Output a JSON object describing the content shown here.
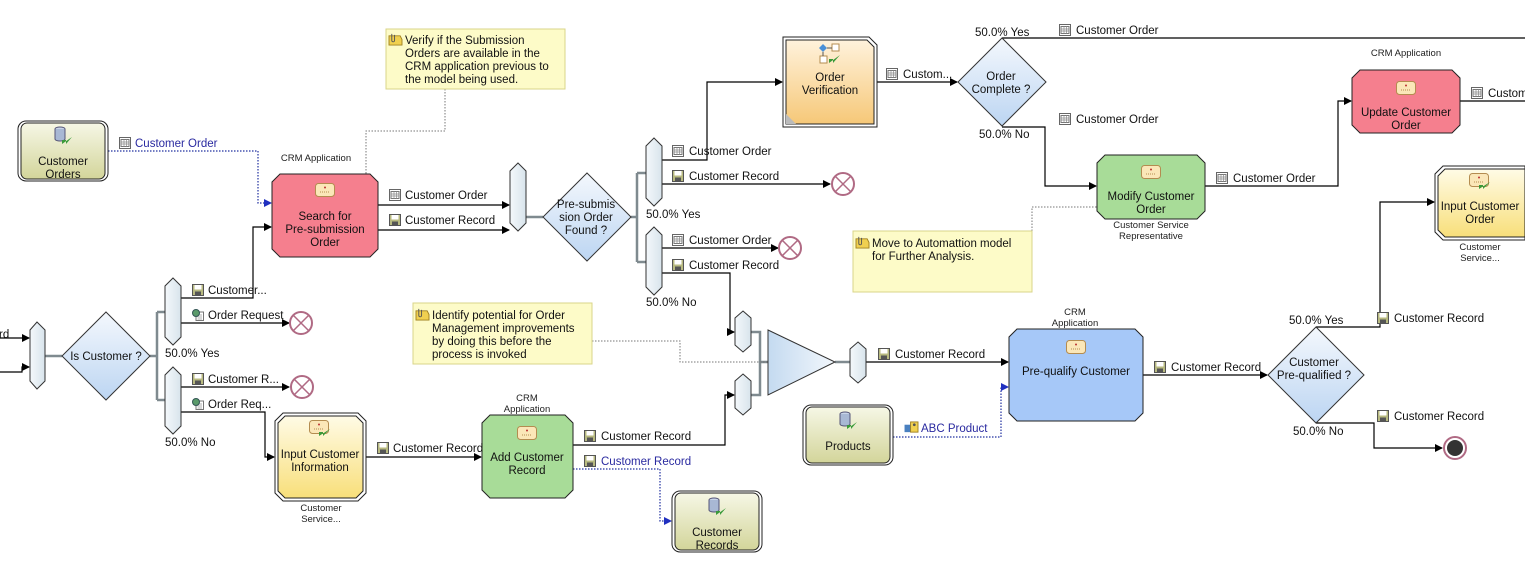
{
  "colors": {
    "crm_task": "#f57f8e",
    "human_task": "#a8dc98",
    "manual_task": "#fbe890",
    "subprocess": "#f8d08c",
    "prequalify_task": "#a6c8f8",
    "decision": "#cfe0f5",
    "note": "#fdfbc8",
    "repository": "#e0e2b0",
    "data_link": "#2a2aa0"
  },
  "repositories": {
    "customer_orders": {
      "line1": "Customer",
      "line2": "Orders",
      "icon": "database-icon"
    },
    "products": {
      "line1": "Products",
      "icon": "database-icon"
    },
    "customer_records": {
      "line1": "Customer",
      "line2": "Records",
      "icon": "database-icon"
    }
  },
  "tasks": {
    "search": {
      "line1": "Search for",
      "line2": "Pre-submission",
      "line3": "Order",
      "role": "CRM Application"
    },
    "order_verification": {
      "line1": "Order",
      "line2": "Verification"
    },
    "modify": {
      "line1": "Modify Customer",
      "line2": "Order",
      "role1": "Customer Service",
      "role2": "Representative"
    },
    "update": {
      "line1": "Update Customer",
      "line2": "Order",
      "role": "CRM Application"
    },
    "input_order": {
      "line1": "Input Customer",
      "line2": "Order",
      "role1": "Customer",
      "role2": "Service..."
    },
    "input_info": {
      "line1": "Input Customer",
      "line2": "Information",
      "role1": "Customer",
      "role2": "Service..."
    },
    "add_record": {
      "line1": "Add Customer",
      "line2": "Record",
      "role1": "CRM",
      "role2": "Application"
    },
    "prequalify": {
      "line1": "Pre-qualify Customer",
      "role1": "CRM",
      "role2": "Application"
    }
  },
  "decisions": {
    "is_customer": {
      "line1": "Is Customer ?"
    },
    "presubmission": {
      "line1": "Pre-submis",
      "line2": "sion Order",
      "line3": "Found ?"
    },
    "order_complete": {
      "line1": "Order",
      "line2": "Complete ?"
    },
    "prequalified": {
      "line1": "Customer",
      "line2": "Pre-qualified ?"
    }
  },
  "notes": {
    "verify": [
      "Verify if the Submission",
      "Orders are available in the",
      "CRM application previous to",
      "the model being used."
    ],
    "identify": [
      "Identify potential for Order",
      "Management improvements",
      "by doing this before the",
      "process is invoked"
    ],
    "automation": [
      "Move to Automattion model",
      "for Further Analysis."
    ]
  },
  "connections": {
    "left_in": "rd",
    "orders_to_search": "Customer Order",
    "search_order": "Customer Order",
    "search_record": "Customer Record",
    "yes1_order": "Customer Order",
    "yes1_record": "Customer Record",
    "yes1_pct": "50.0% Yes",
    "no1_order": "Customer Order",
    "no1_record": "Customer Record",
    "no1_pct": "50.0% No",
    "verif_out": "Custom...",
    "oc_yes_pct": "50.0% Yes",
    "oc_yes_order": "Customer Order",
    "oc_no_pct": "50.0% No",
    "oc_no_order": "Customer Order",
    "modify_out": "Customer Order",
    "update_out": "Custome",
    "ic_yes_record": "Customer...",
    "ic_yes_request": "Order Request",
    "ic_yes_pct": "50.0% Yes",
    "ic_no_record": "Customer R...",
    "ic_no_request": "Order Req...",
    "ic_no_pct": "50.0% No",
    "info_out": "Customer Record",
    "add_out": "Customer Record",
    "add_to_repo": "Customer Record",
    "merge_out": "Customer Record",
    "abc_product": "ABC Product",
    "prequal_out": "Customer Record",
    "pq_yes_pct": "50.0% Yes",
    "pq_yes_record": "Customer Record",
    "pq_no_pct": "50.0% No",
    "pq_no_record": "Customer Record"
  }
}
